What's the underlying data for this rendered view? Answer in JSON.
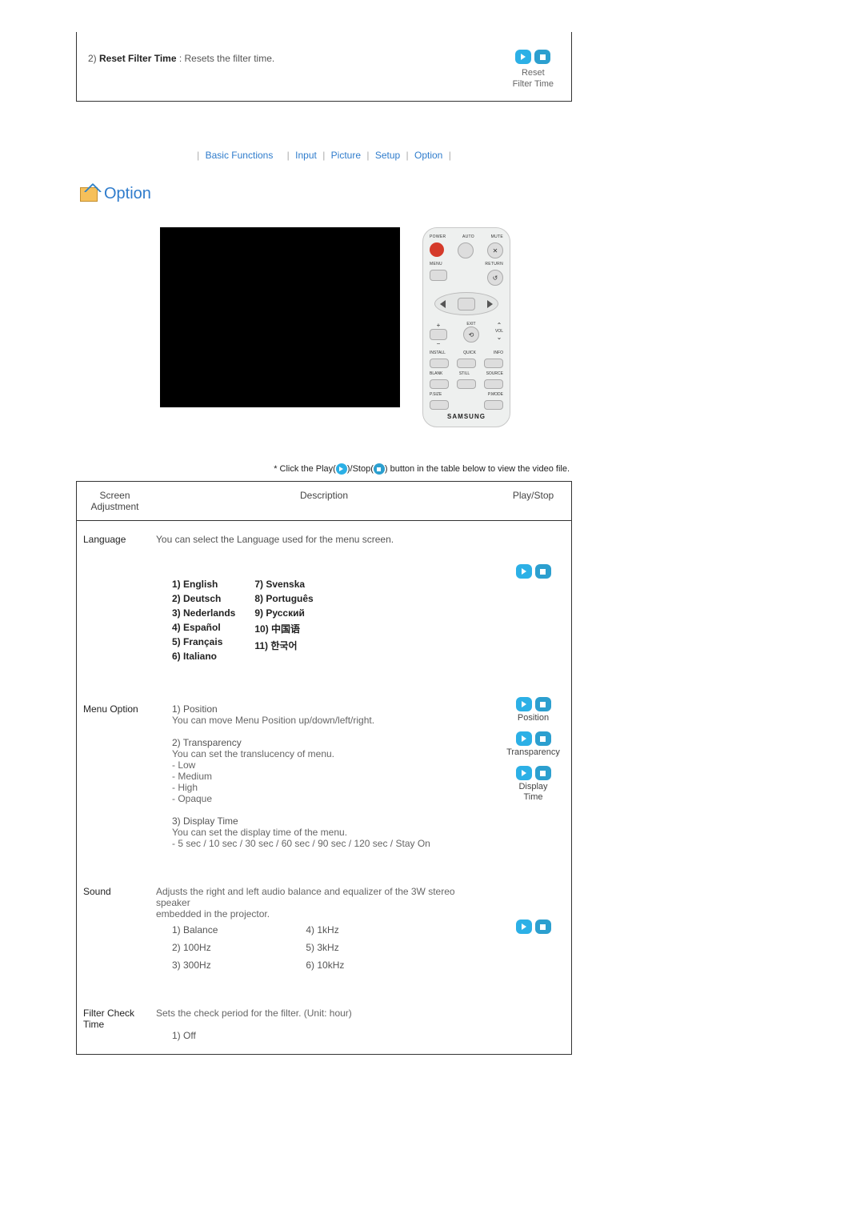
{
  "topbox": {
    "line_prefix": "2) ",
    "line_bold": "Reset Filter Time",
    "line_rest": " : Resets the filter time.",
    "reset_label_1": "Reset",
    "reset_label_2": "Filter Time"
  },
  "nav": {
    "basic": "Basic Functions",
    "input": "Input",
    "picture": "Picture",
    "setup": "Setup",
    "option": "Option"
  },
  "option_header": "Option",
  "remote": {
    "power": "POWER",
    "auto": "AUTO",
    "mute": "MUTE",
    "menu": "MENU",
    "return": "RETURN",
    "exit": "EXIT",
    "vol": "VOL",
    "install": "INSTALL",
    "quick": "QUICK",
    "info": "INFO",
    "blank": "BLANK",
    "still": "STILL",
    "source": "SOURCE",
    "psize": "P.SIZE",
    "pmode": "P.MODE",
    "brand": "SAMSUNG"
  },
  "hint": {
    "pre": "* Click the Play(",
    "mid": ")/Stop(",
    "post": ") button in the table below to view the video file."
  },
  "table": {
    "head_col1_l1": "Screen",
    "head_col1_l2": "Adjustment",
    "head_col2": "Description",
    "head_col3": "Play/Stop",
    "language": {
      "label": "Language",
      "desc": "You can select the Language used for the menu screen.",
      "col_a": [
        "1) English",
        "2) Deutsch",
        "3) Nederlands",
        "4) Español",
        "5) Français",
        "6) Italiano"
      ],
      "col_b": [
        "7) Svenska",
        "8) Português",
        "9) Русский",
        "10) 中国语",
        "11) 한국어"
      ]
    },
    "menuoption": {
      "label": "Menu Option",
      "pos_title": "1) Position",
      "pos_desc": "You can move Menu Position up/down/left/right.",
      "tr_title": "2) Transparency",
      "tr_desc": "You can set the translucency of menu.",
      "tr_items": [
        "- Low",
        "- Medium",
        "- High",
        "- Opaque"
      ],
      "dt_title": "3) Display Time",
      "dt_desc": "You can set the display time of the menu.",
      "dt_items": "- 5 sec / 10 sec / 30 sec / 60 sec / 90 sec / 120 sec / Stay On",
      "ps_pos": "Position",
      "ps_tr": "Transparency",
      "ps_dt_l1": "Display",
      "ps_dt_l2": "Time"
    },
    "sound": {
      "label": "Sound",
      "desc_l1": "Adjusts the right and left audio balance and equalizer of the 3W stereo speaker",
      "desc_l2": "embedded in the projector.",
      "col_a": [
        "1) Balance",
        "2) 100Hz",
        "3) 300Hz"
      ],
      "col_b": [
        "4) 1kHz",
        "5) 3kHz",
        "6) 10kHz"
      ]
    },
    "filter": {
      "label_l1": "Filter Check",
      "label_l2": "Time",
      "desc": "Sets the check period for the filter. (Unit: hour)",
      "items": [
        "1) Off"
      ]
    }
  }
}
